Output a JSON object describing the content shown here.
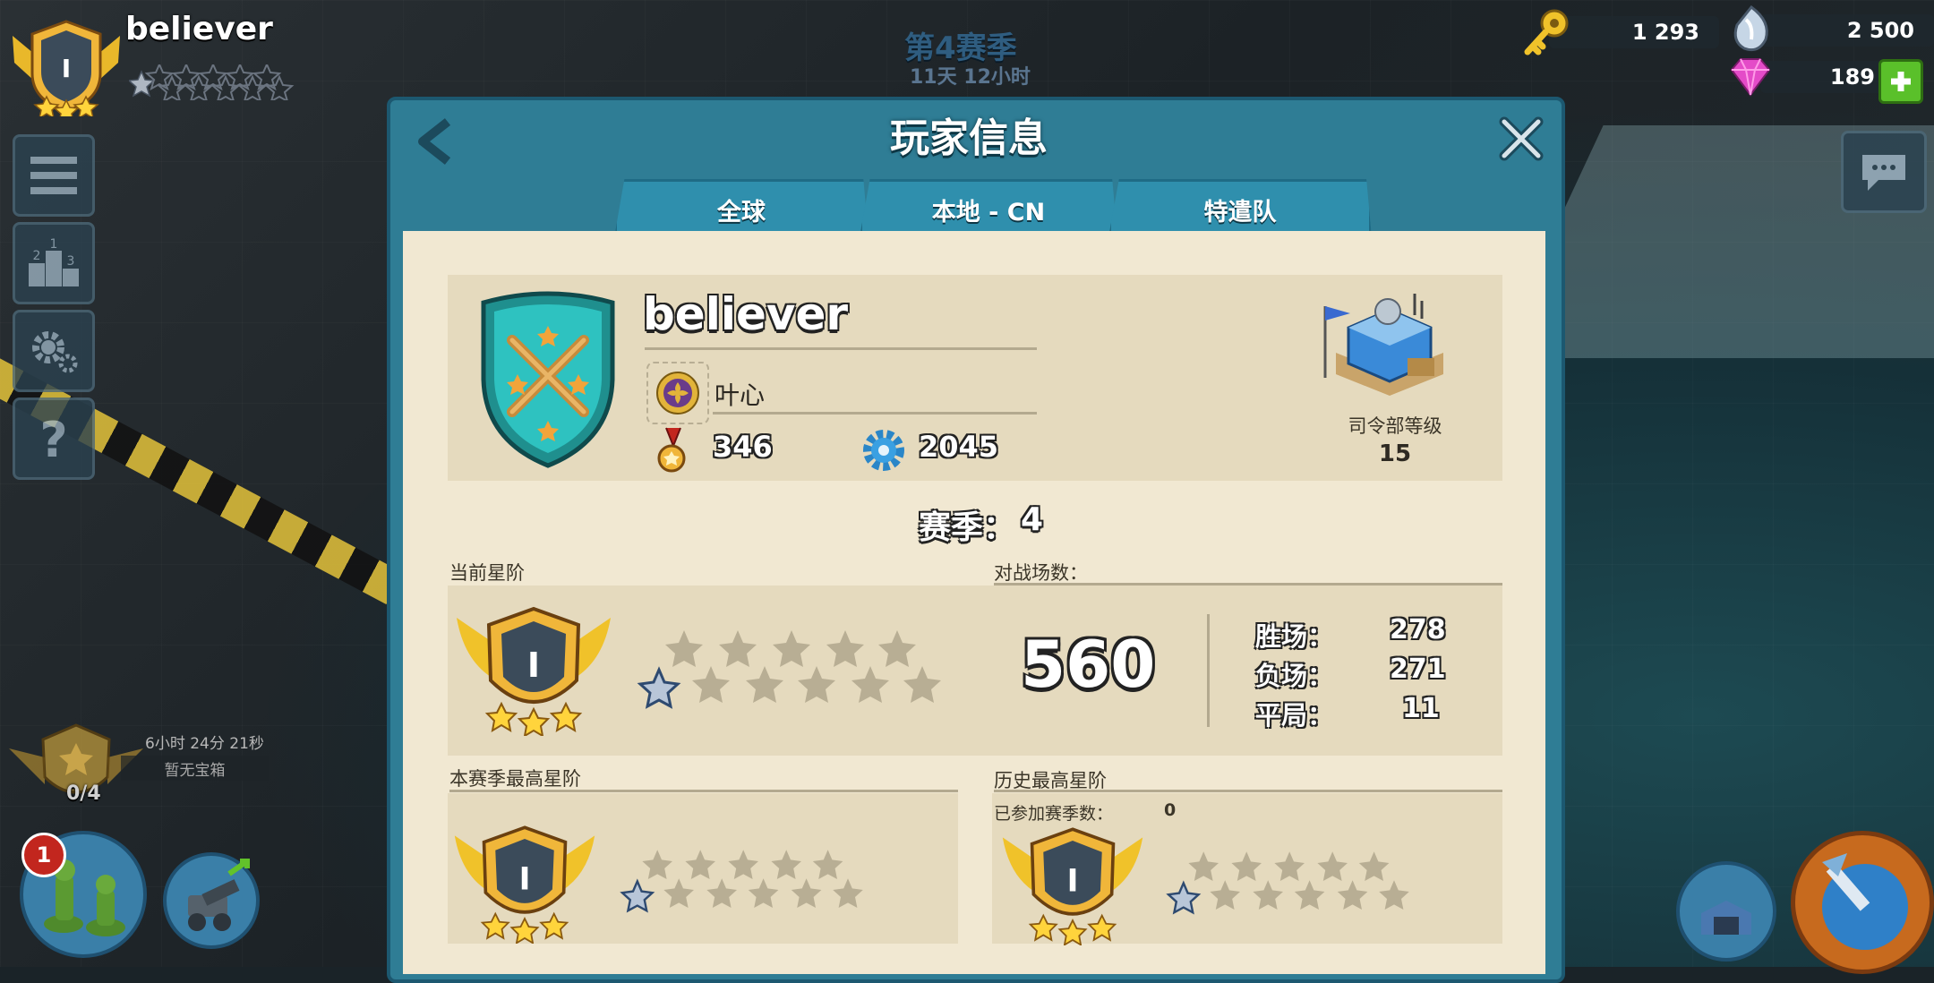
{
  "top_player": {
    "name": "believer",
    "rank": "I"
  },
  "season_banner": {
    "title": "第4赛季",
    "countdown": "11天 12小时"
  },
  "resources": {
    "keys": "1 293",
    "diamonds": "2 500",
    "gems": "189"
  },
  "chest": {
    "timer": "6小时 24分 21秒",
    "status": "暂无宝箱",
    "count": "0/4"
  },
  "notification_count": "1",
  "dialog": {
    "title": "玩家信息",
    "tabs": [
      "全球",
      "本地 - CN",
      "特遣队"
    ],
    "player": {
      "name": "believer",
      "task_force": "叶心",
      "medals": "346",
      "gears": "2045",
      "hq_label": "司令部等级",
      "hq_level": "15"
    },
    "season_label": "赛季：",
    "season_value": "4",
    "current_rank_label": "当前星阶",
    "rank_numeral": "I",
    "battles_label": "对战场数：",
    "battles_count": "560",
    "wins_label": "胜场：",
    "wins": "278",
    "losses_label": "负场：",
    "losses": "271",
    "draws_label": "平局：",
    "draws": "11",
    "season_best_label": "本赛季最高星阶",
    "history_best_label": "历史最高星阶",
    "seasons_played_label": "已参加赛季数：",
    "seasons_played": "0"
  },
  "colors": {
    "panel": "#2f7d95",
    "paper": "#f1e8d2",
    "section": "#e5dabe",
    "gold": "#f2c12e"
  }
}
